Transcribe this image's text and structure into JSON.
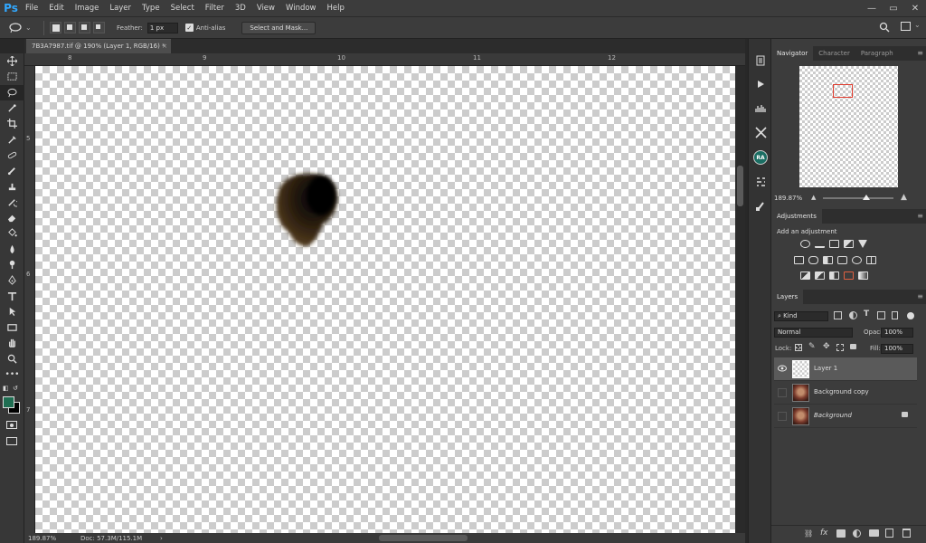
{
  "app": {
    "logo": "Ps"
  },
  "menu": [
    "File",
    "Edit",
    "Image",
    "Layer",
    "Type",
    "Select",
    "Filter",
    "3D",
    "View",
    "Window",
    "Help"
  ],
  "window_controls": {
    "minimize": "—",
    "restore": "▭",
    "close": "✕"
  },
  "options": {
    "feather_label": "Feather:",
    "feather_value": "1 px",
    "antialias_label": "Anti-alias",
    "antialias_checked": true,
    "select_mask_label": "Select and Mask..."
  },
  "document": {
    "tab_title": "7B3A7987.tif @ 190% (Layer 1, RGB/16) *",
    "close": "×"
  },
  "ruler": {
    "top": [
      "8",
      "9",
      "10",
      "11",
      "12"
    ],
    "left": [
      "5",
      "6",
      "7"
    ]
  },
  "status": {
    "zoom": "189.87%",
    "doc": "Doc: 57.3M/115.1M",
    "arrow": "›"
  },
  "navigator": {
    "tabs": [
      "Navigator",
      "Character",
      "Paragraph"
    ],
    "zoom": "189.87%"
  },
  "adjustments": {
    "title": "Adjustments",
    "subtitle": "Add an adjustment"
  },
  "layers_panel": {
    "title": "Layers",
    "filter_kind": "Kind",
    "blend_mode": "Normal",
    "opacity_label": "Opacity:",
    "opacity_value": "100%",
    "lock_label": "Lock:",
    "fill_label": "Fill:",
    "fill_value": "100%"
  },
  "layers": [
    {
      "name": "Layer 1",
      "visible": true,
      "selected": true
    },
    {
      "name": "Background copy",
      "visible": false,
      "selected": false
    },
    {
      "name": "Background",
      "visible": false,
      "selected": false,
      "locked": true
    }
  ],
  "colors": {
    "foreground": "#1f6e52",
    "background": "#000000",
    "accent": "#31a8ff",
    "nav_box": "#e0392b"
  },
  "mid_panel_icons": [
    "history-icon",
    "play-icon",
    "levels-icon",
    "tools-icon",
    "ra-icon",
    "properties-icon",
    "brush-icon"
  ],
  "mid_ra_label": "RA"
}
